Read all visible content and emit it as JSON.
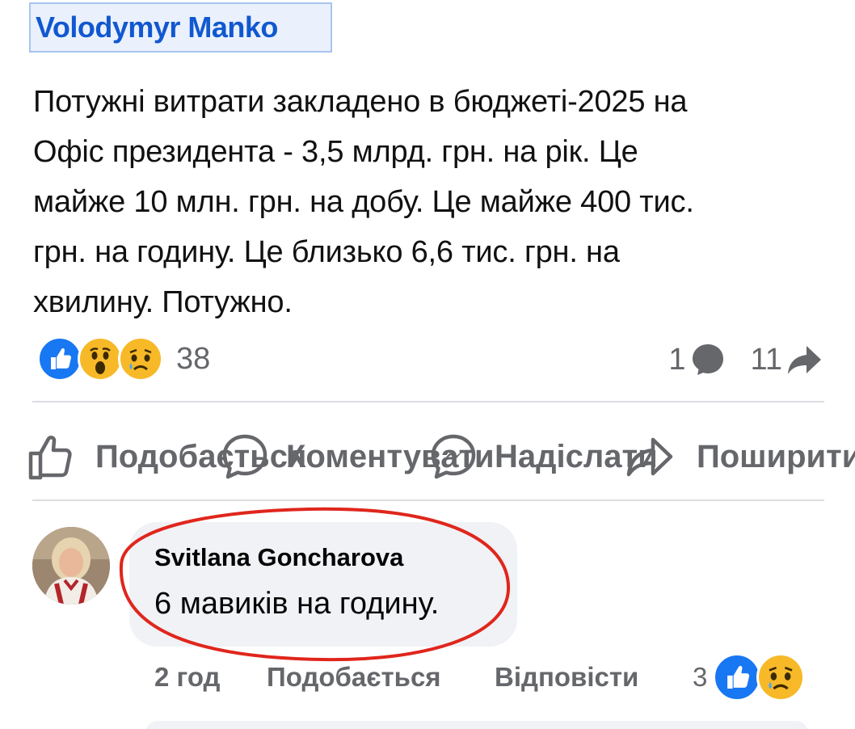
{
  "post": {
    "author": "Volodymyr Manko",
    "text_lines": [
      "Потужні витрати закладено в бюджеті-2025 на",
      "Офіс президента - 3,5 млрд. грн. на рік. Це",
      "майже 10 млн. грн. на добу. Це майже 400 тис.",
      "грн. на годину. Це близько 6,6 тис. грн. на",
      "хвилину. Потужно."
    ],
    "reactions": {
      "icons": [
        "like-icon",
        "wow-icon",
        "sad-icon"
      ],
      "count": "38"
    },
    "comments_count": "1",
    "shares_count": "11"
  },
  "actions": {
    "like": "Подобається",
    "comment": "Коментувати",
    "send": "Надіслати",
    "share": "Поширити"
  },
  "comment": {
    "author": "Svitlana Goncharova",
    "text": "6 мавиків на годину.",
    "time": "2 год",
    "like": "Подобається",
    "reply": "Відповісти",
    "reaction_count": "3",
    "reaction_icons": [
      "like-icon",
      "sad-icon"
    ]
  },
  "colors": {
    "link_blue": "#1158d0",
    "author_highlight": "#eaf1fd",
    "meta_gray": "#65676b",
    "bubble": "#f0f2f5",
    "annotation_red": "#e0261c",
    "like_blue": "#1877f2",
    "emoji_yellow": "#f7b928"
  }
}
